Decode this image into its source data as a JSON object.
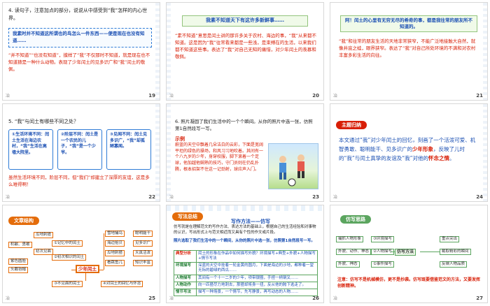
{
  "slides": [
    {
      "number": "19",
      "q_title": "4. 读句子，注意加点的部分，说说从中感受到“我”怎样的内心世界。",
      "box_quote": "我素时并不知道这所谓也的鸟怎么一件东西——便是现在也没有知道……",
      "body": "“并不知道”“也没有知道”，摸样了“我”不仅那时不知道，就是现在也不知道猹是一种什么动物。表现了少年闰土的见多识广和“我”闰土的敬佩。",
      "corner": "冶"
    },
    {
      "number": "20",
      "banner": "我素不知道天下有这许多新鲜事……",
      "body": "“素不知道”意思是闰土讲的那许多关于农村、海边的事，“我”从来都不知道。这是因为“我”往常看来都是一些浅，是束缚在的生活，以来我们都不知道这些事。表达了“我”对自己无知的痛惜，对少年闰土的羡慕和敬佩。",
      "corner": "冶"
    },
    {
      "number": "21",
      "banner": "阿！闰土的心里有无穷无尽的希奇的事，都是我往常的朋友所不知道的。",
      "body": "“我”和往常的朋友生活的天地非常狭窄，不能广泛地接触大自然，就像井底之蛙，眼界狭窄。表达了“我”对自己所处环境的不满和对农村丰富多彩生活的向往。",
      "corner": "冶"
    },
    {
      "number": "22",
      "q_title": "5. “我”与闰土有哪些不同之处？",
      "cards": [
        "①生活环境不同：闰土生活在海边农村，“我”生活在高墙大院里。",
        "②阶层不同：闰土是一个农民的儿子，“我”是一个少爷。",
        "③见闻不同：闰土见多识广，“我”却孤陋寡闻。"
      ],
      "conclusion": "虽然生活环境不同，阶层不同，但“我们”却建立了深厚的友谊，这是多么难得啊！",
      "corner": "冶"
    },
    {
      "number": "23",
      "q_title": "6. 照片凝固了我们生活中的一个个瞬间。从你的照片中选一张，仿照第1自然段写一写。",
      "example_label": "示例",
      "example": "蔚蓝的天空中飘着几朵洁白的云彩，下面是宽阔平坦的绿色的操场，和风习习地吹着。其间有一个八九岁的少年，身穿校服，脚下滚着一个足球，他加越他娴熟的技巧，守门员则在仍乱扑腾，根本招架不住这一记劲射，球应声入门。",
      "corner": "冶"
    },
    {
      "number": "24",
      "badge": "主题归纳",
      "summary_a": "本文通过“我”对少年闰土的回忆，刻画了一个活泼可爱、机智勇敢、聪明能干、见多识广的",
      "summary_b": "少年形象",
      "summary_c": "，反映了儿时的“我”与闰土真挚的友谊及“我”对他的",
      "summary_d": "怀念之情",
      "summary_e": "。",
      "corner": "冶"
    },
    {
      "number": "25",
      "badge": "文章结构",
      "center": "少年闰土",
      "left_nodes": [
        "瓜地刺猹",
        "初次见面",
        "紫色圆脸",
        "头戴毡帽",
        "机敏、勇敢"
      ],
      "left_mid": [
        "①记忆中的闰土",
        "②初次相识的闰土"
      ],
      "right_nodes": [
        "雪地捕鸟",
        "海边拾贝",
        "瓜地刺猹",
        "看跳鱼儿"
      ],
      "right_tail": [
        "聪明能干",
        "见多识广",
        "天真活泼",
        "知识丰富"
      ],
      "bottom": [
        "③不见面的闰土",
        "④对闰土的回忆与怀念"
      ],
      "corner": "冶"
    },
    {
      "number": "26",
      "badge": "写法总结",
      "title": "写作方法——仿写",
      "intro": "仿写就是在理解范文的写作方法、表达方法的基础上，根据自己的生活经验和对事物的认识，写出形式上与范文相近而又具有个性的作文或片段。",
      "step": "照片选取了我们生活中的一个瞬间，从你的照片中选一张，仿照第1自然段写一写。",
      "rows": [
        [
          "典型分析",
          "闰土的形象在作品中如何描写外貌？环境描写+典型+外貌+人物描写+情节写法"
        ],
        [
          "环境描写",
          "深蓝的天空中挂着一轮金黄的圆月，下面是海边的沙地，都种着一望无际的碧绿的西瓜……"
        ],
        [
          "人物描写",
          "其间有一个十一二岁的少年，项带银圈，手捏一柄钢叉……"
        ],
        [
          "人物动作",
          "向一匹猹尽力地刺去，那猹却将身一扭，反从他的胯下逃走了。"
        ],
        [
          "情节写法",
          "描写一种场景，一个情节，先写静景，再写动态的人物……"
        ]
      ],
      "corner": "冶"
    },
    {
      "number": "27",
      "badge": "仿写思路",
      "center": "仿写方法",
      "left": [
        "捕抓人物形象",
        "外貌、动作、神态",
        "外貌、神态"
      ],
      "mid": [
        "③环境描写",
        "②人物描写",
        "①事件描写"
      ],
      "right": [
        "重点突出",
        "截取精彩的瞬间",
        "反映人物品质"
      ],
      "note": "注意：仿写不是机械模仿，更不是抄袭。仿写既要借鉴范文的方法，又要发挥创新精神。",
      "corner": "冶"
    }
  ]
}
